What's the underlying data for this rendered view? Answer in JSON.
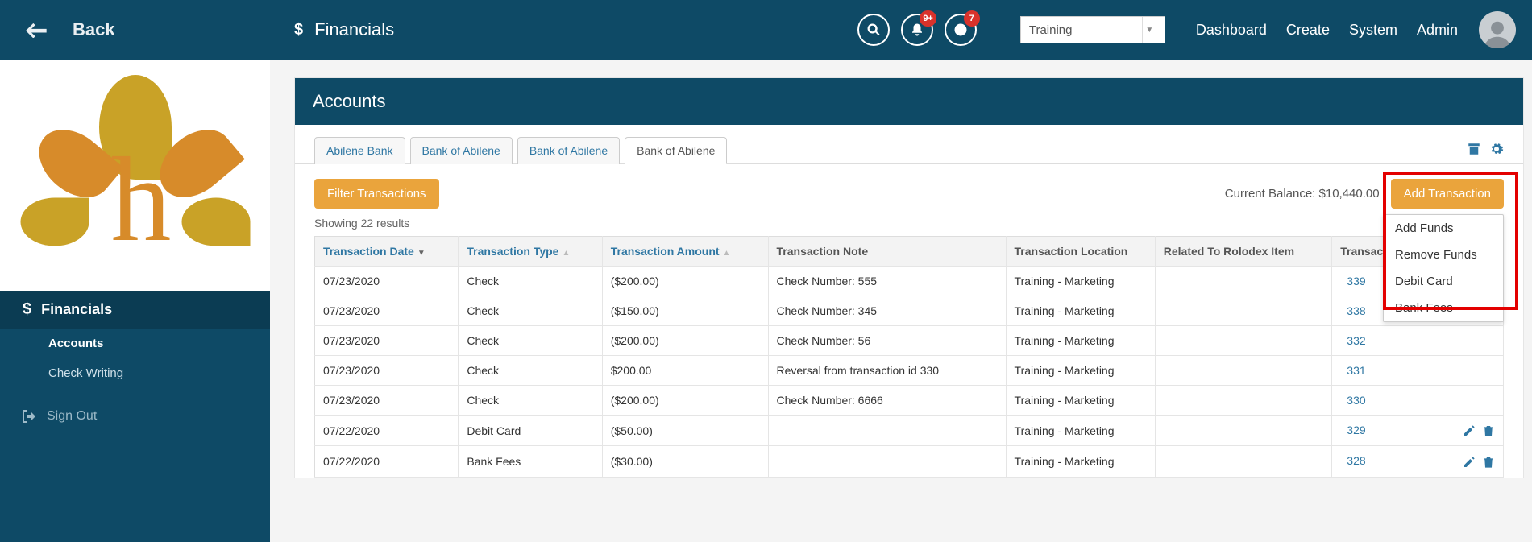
{
  "sidebar": {
    "back_label": "Back",
    "section_label": "Financials",
    "items": [
      {
        "label": "Accounts",
        "active": true
      },
      {
        "label": "Check Writing",
        "active": false
      }
    ],
    "signout_label": "Sign Out"
  },
  "topbar": {
    "title": "Financials",
    "badges": {
      "bell": "9+",
      "clock": "7"
    },
    "env_selected": "Training",
    "nav": [
      "Dashboard",
      "Create",
      "System",
      "Admin"
    ]
  },
  "panel": {
    "title": "Accounts",
    "tabs": [
      "Abilene Bank",
      "Bank of Abilene",
      "Bank of Abilene",
      "Bank of Abilene"
    ],
    "active_tab_index": 3,
    "filter_label": "Filter Transactions",
    "balance_label": "Current Balance: ",
    "balance_value": "$10,440.00",
    "add_tx_label": "Add Transaction",
    "add_tx_menu": [
      "Add Funds",
      "Remove Funds",
      "Debit Card",
      "Bank Fees"
    ],
    "results_text": "Showing 22 results",
    "columns": [
      "Transaction Date",
      "Transaction Type",
      "Transaction Amount",
      "Transaction Note",
      "Transaction Location",
      "Related To Rolodex Item",
      "Transaction"
    ],
    "rows": [
      {
        "date": "07/23/2020",
        "type": "Check",
        "amount": "($200.00)",
        "note": "Check Number: 555",
        "location": "Training - Marketing",
        "rolodex": "",
        "txid": "339",
        "editable": false
      },
      {
        "date": "07/23/2020",
        "type": "Check",
        "amount": "($150.00)",
        "note": "Check Number: 345",
        "location": "Training - Marketing",
        "rolodex": "",
        "txid": "338",
        "editable": false
      },
      {
        "date": "07/23/2020",
        "type": "Check",
        "amount": "($200.00)",
        "note": "Check Number: 56",
        "location": "Training - Marketing",
        "rolodex": "",
        "txid": "332",
        "editable": false
      },
      {
        "date": "07/23/2020",
        "type": "Check",
        "amount": "$200.00",
        "note": "Reversal from transaction id 330",
        "location": "Training - Marketing",
        "rolodex": "",
        "txid": "331",
        "editable": false
      },
      {
        "date": "07/23/2020",
        "type": "Check",
        "amount": "($200.00)",
        "note": "Check Number: 6666",
        "location": "Training - Marketing",
        "rolodex": "",
        "txid": "330",
        "editable": false
      },
      {
        "date": "07/22/2020",
        "type": "Debit Card",
        "amount": "($50.00)",
        "note": "",
        "location": "Training - Marketing",
        "rolodex": "",
        "txid": "329",
        "editable": true
      },
      {
        "date": "07/22/2020",
        "type": "Bank Fees",
        "amount": "($30.00)",
        "note": "",
        "location": "Training - Marketing",
        "rolodex": "",
        "txid": "328",
        "editable": true
      }
    ]
  }
}
